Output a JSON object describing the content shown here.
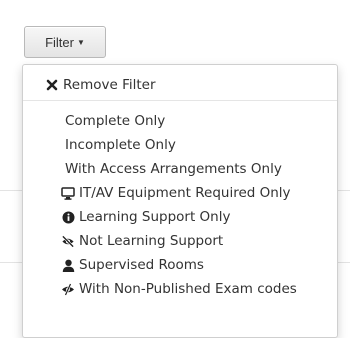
{
  "filter_button": {
    "label": "Filter",
    "caret_icon": "caret-down-icon"
  },
  "menu": {
    "remove": {
      "label": "Remove Filter",
      "icon": "times-icon"
    },
    "items": [
      {
        "label": "Complete Only",
        "icon": ""
      },
      {
        "label": "Incomplete Only",
        "icon": ""
      },
      {
        "label": "With Access Arrangements Only",
        "icon": ""
      },
      {
        "label": "IT/AV Equipment Required Only",
        "icon": "desktop-icon"
      },
      {
        "label": "Learning Support Only",
        "icon": "info-circle-icon"
      },
      {
        "label": "Not Learning Support",
        "icon": "eye-slash-icon"
      },
      {
        "label": "Supervised Rooms",
        "icon": "user-icon"
      },
      {
        "label": "With Non-Published Exam codes",
        "icon": "no-view-icon"
      }
    ]
  }
}
